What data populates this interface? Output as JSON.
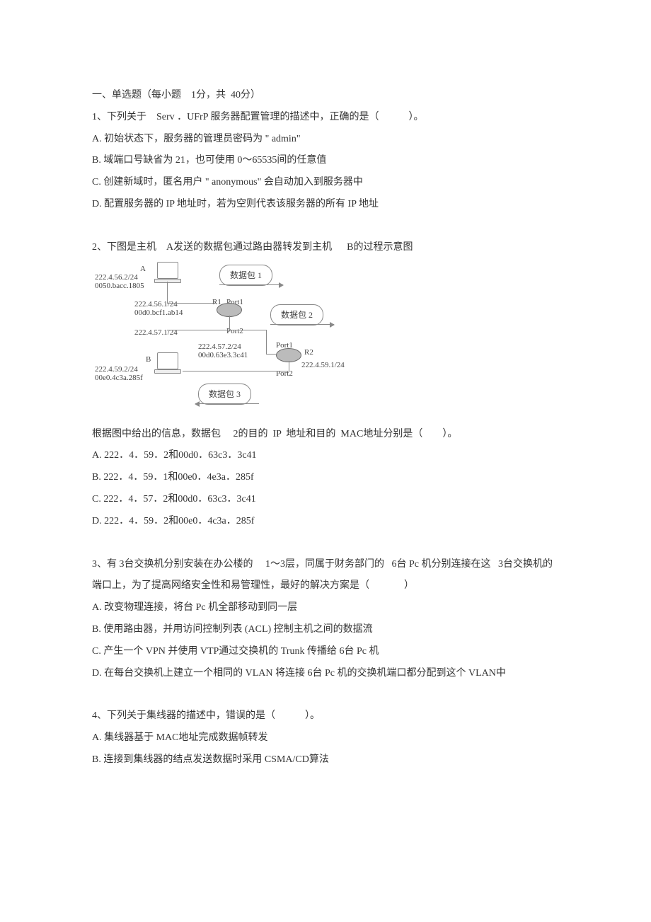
{
  "section_title": "一、单选题（每小题    1分，共  40分）",
  "q1": {
    "stem": "1、下列关于    Serv ．UFrP 服务器配置管理的描述中，正确的是（            ）。",
    "A": "A.  初始状态下，服务器的管理员密码为 \"    admin\"",
    "B": "B.  域端口号缺省为    21，也可使用  0～65535间的任意值",
    "C": "C.  创建新域时，匿名用户 \"    anonymous\" 会自动加入到服务器中",
    "D": "D.  配置服务器的    IP  地址时，若为空则代表该服务器的所有      IP  地址"
  },
  "q2": {
    "stem": "2、下图是主机    A发送的数据包通过路由器转发到主机      B的过程示意图",
    "diagram": {
      "hostA_label": "A",
      "hostA_ip": "222.4.56.2/24",
      "hostA_mac": "0050.bacc.1805",
      "pkt1": "数据包 1",
      "r1_p1_ip": "222.4.56.1/24",
      "r1_p1_mac": "00d0.bcf1.ab14",
      "r1_label": "R1",
      "r1_port1": "Port1",
      "pkt2": "数据包 2",
      "r1_p2_ip": "222.4.57.1/24",
      "r1_port2": "Port2",
      "r2_p1_ip": "222.4.57.2/24",
      "r2_p1_mac": "00d0.63e3.3c41",
      "r2_port1": "Port1",
      "r2_label": "R2",
      "r2_p2_ip": "222.4.59.1/24",
      "r2_port2": "Port2",
      "hostB_label": "B",
      "hostB_ip": "222.4.59.2/24",
      "hostB_mac": "00e0.4c3a.285f",
      "pkt3": "数据包 3"
    },
    "tail": "根据图中给出的信息，数据包     2的目的  IP  地址和目的  MAC地址分别是（        ）。",
    "A": "A.  222．4．59．2和00d0．63c3．3c41",
    "B": "B.  222．4．59．1和00e0．4e3a．285f",
    "C": "C.  222．4．57．2和00d0．63c3．3c41",
    "D": "D.  222．4．59．2和00e0．4c3a．285f"
  },
  "q3": {
    "stem": "3、有 3台交换机分别安装在办公楼的     1～3层，同属于财务部门的   6台 Pc 机分别连接在这   3台交换机的端口上，为了提高网络安全性和易管理性，最好的解决方案是（              ）",
    "A": "A.  改变物理连接，将台      Pc 机全部移动到同一层",
    "B": "B.  使用路由器，并用访问控制列表      (ACL) 控制主机之间的数据流",
    "C": "C.  产生一个   VPN  并使用  VTP通过交换机的   Trunk  传播给 6台  Pc 机",
    "D": "D.  在每台交换机上建立一个相同的     VLAN  将连接 6台  Pc 机的交换机端口都分配到这个      VLAN中"
  },
  "q4": {
    "stem": "4、下列关于集线器的描述中，错误的是（            ）。",
    "A": "A.  集线器基于   MAC地址完成数据帧转发",
    "B": "B.  连接到集线器的结点发送数据时采用      CSMA/CD算法"
  }
}
